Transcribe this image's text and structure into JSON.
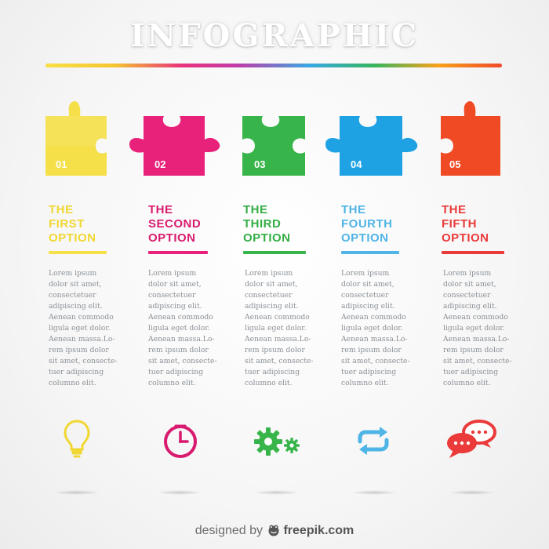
{
  "title": "INFOGRAPHIC",
  "options": [
    {
      "number": "01",
      "heading": [
        "THE",
        "FIRST",
        "OPTION"
      ],
      "color": "#f5e04a",
      "text_color": "#f0d732",
      "icon": "lightbulb-icon",
      "body": [
        "Lorem ipsum",
        "dolor sit amet,",
        "consectetuer",
        "adipiscing elit.",
        "Aenean commodo",
        "ligula eget dolor.",
        "Aenean massa.Lo-",
        "rem ipsum dolor",
        "sit amet, consecte-",
        "tuer adipiscing",
        "columno elit."
      ]
    },
    {
      "number": "02",
      "heading": [
        "THE",
        "SECOND",
        "OPTION"
      ],
      "color": "#e8217a",
      "text_color": "#d81b6e",
      "icon": "clock-icon",
      "body": [
        "Lorem ipsum",
        "dolor sit amet,",
        "consectetuer",
        "adipiscing elit.",
        "Aenean commodo",
        "ligula eget dolor.",
        "Aenean massa.Lo-",
        "rem ipsum dolor",
        "sit amet, consecte-",
        "tuer adipiscing",
        "columno elit."
      ]
    },
    {
      "number": "03",
      "heading": [
        "THE",
        "THIRD",
        "OPTION"
      ],
      "color": "#38b54a",
      "text_color": "#33ad44",
      "icon": "gears-icon",
      "body": [
        "Lorem ipsum",
        "dolor sit amet,",
        "consectetuer",
        "adipiscing elit.",
        "Aenean commodo",
        "ligula eget dolor.",
        "Aenean massa.Lo-",
        "rem ipsum dolor",
        "sit amet, consecte-",
        "tuer adipiscing",
        "columno elit."
      ]
    },
    {
      "number": "04",
      "heading": [
        "THE",
        "FOURTH",
        "OPTION"
      ],
      "color": "#1ea2e4",
      "text_color": "#4fb4e6",
      "icon": "refresh-arrows-icon",
      "body": [
        "Lorem ipsum",
        "dolor sit amet,",
        "consectetuer",
        "adipiscing elit.",
        "Aenean commodo",
        "ligula eget dolor.",
        "Aenean massa.Lo-",
        "rem ipsum dolor",
        "sit amet, consecte-",
        "tuer adipiscing",
        "columno elit."
      ]
    },
    {
      "number": "05",
      "heading": [
        "THE",
        "FIFTH",
        "OPTION"
      ],
      "color": "#ef4a24",
      "text_color": "#ea3a3a",
      "icon": "chat-bubbles-icon",
      "body": [
        "Lorem ipsum",
        "dolor sit amet,",
        "consectetuer",
        "adipiscing elit.",
        "Aenean commodo",
        "ligula eget dolor.",
        "Aenean massa.Lo-",
        "rem ipsum dolor",
        "sit amet, consecte-",
        "tuer adipiscing",
        "columno elit."
      ]
    }
  ],
  "credit": {
    "prefix": "designed by",
    "brand": "freepik.com"
  }
}
